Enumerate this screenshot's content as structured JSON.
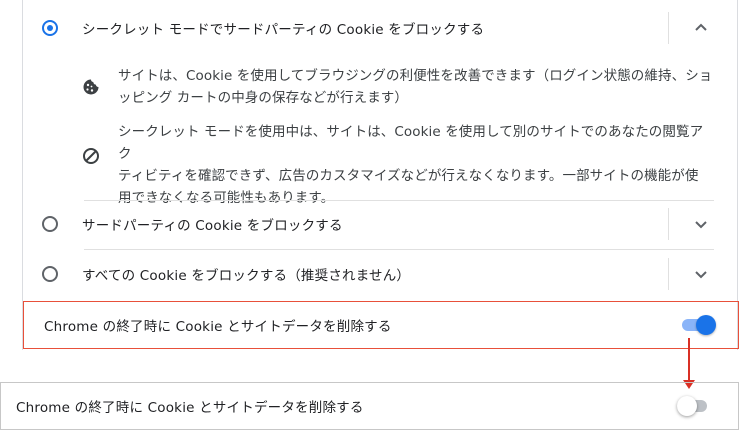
{
  "options": [
    {
      "label": "シークレット モードでサードパーティの Cookie をブロックする",
      "checked": true,
      "expanded": true
    },
    {
      "label": "サードパーティの Cookie をブロックする",
      "checked": false,
      "expanded": false
    },
    {
      "label": "すべての Cookie をブロックする（推奨されません）",
      "checked": false,
      "expanded": false
    }
  ],
  "details": [
    {
      "icon": "cookie-icon",
      "lines": [
        "サイトは、Cookie を使用してブラウジングの利便性を改善できます（ログイン状態の維持、ショ",
        "ッピング カートの中身の保存などが行えます）"
      ]
    },
    {
      "icon": "block-icon",
      "lines": [
        "シークレット モードを使用中は、サイトは、Cookie を使用して別のサイトでのあなたの閲覧アク",
        "ティビティを確認できず、広告のカスタマイズなどが行えなくなります。一部サイトの機能が使",
        "用できなくなる可能性もあります。"
      ]
    }
  ],
  "clear_on_exit": {
    "label": "Chrome の終了時に Cookie とサイトデータを削除する",
    "enabled": true
  },
  "clear_on_exit_after": {
    "label": "Chrome の終了時に Cookie とサイトデータを削除する",
    "enabled": false
  },
  "colors": {
    "accent": "#1a73e8",
    "highlight": "#e8503a",
    "arrow": "#d93025"
  }
}
